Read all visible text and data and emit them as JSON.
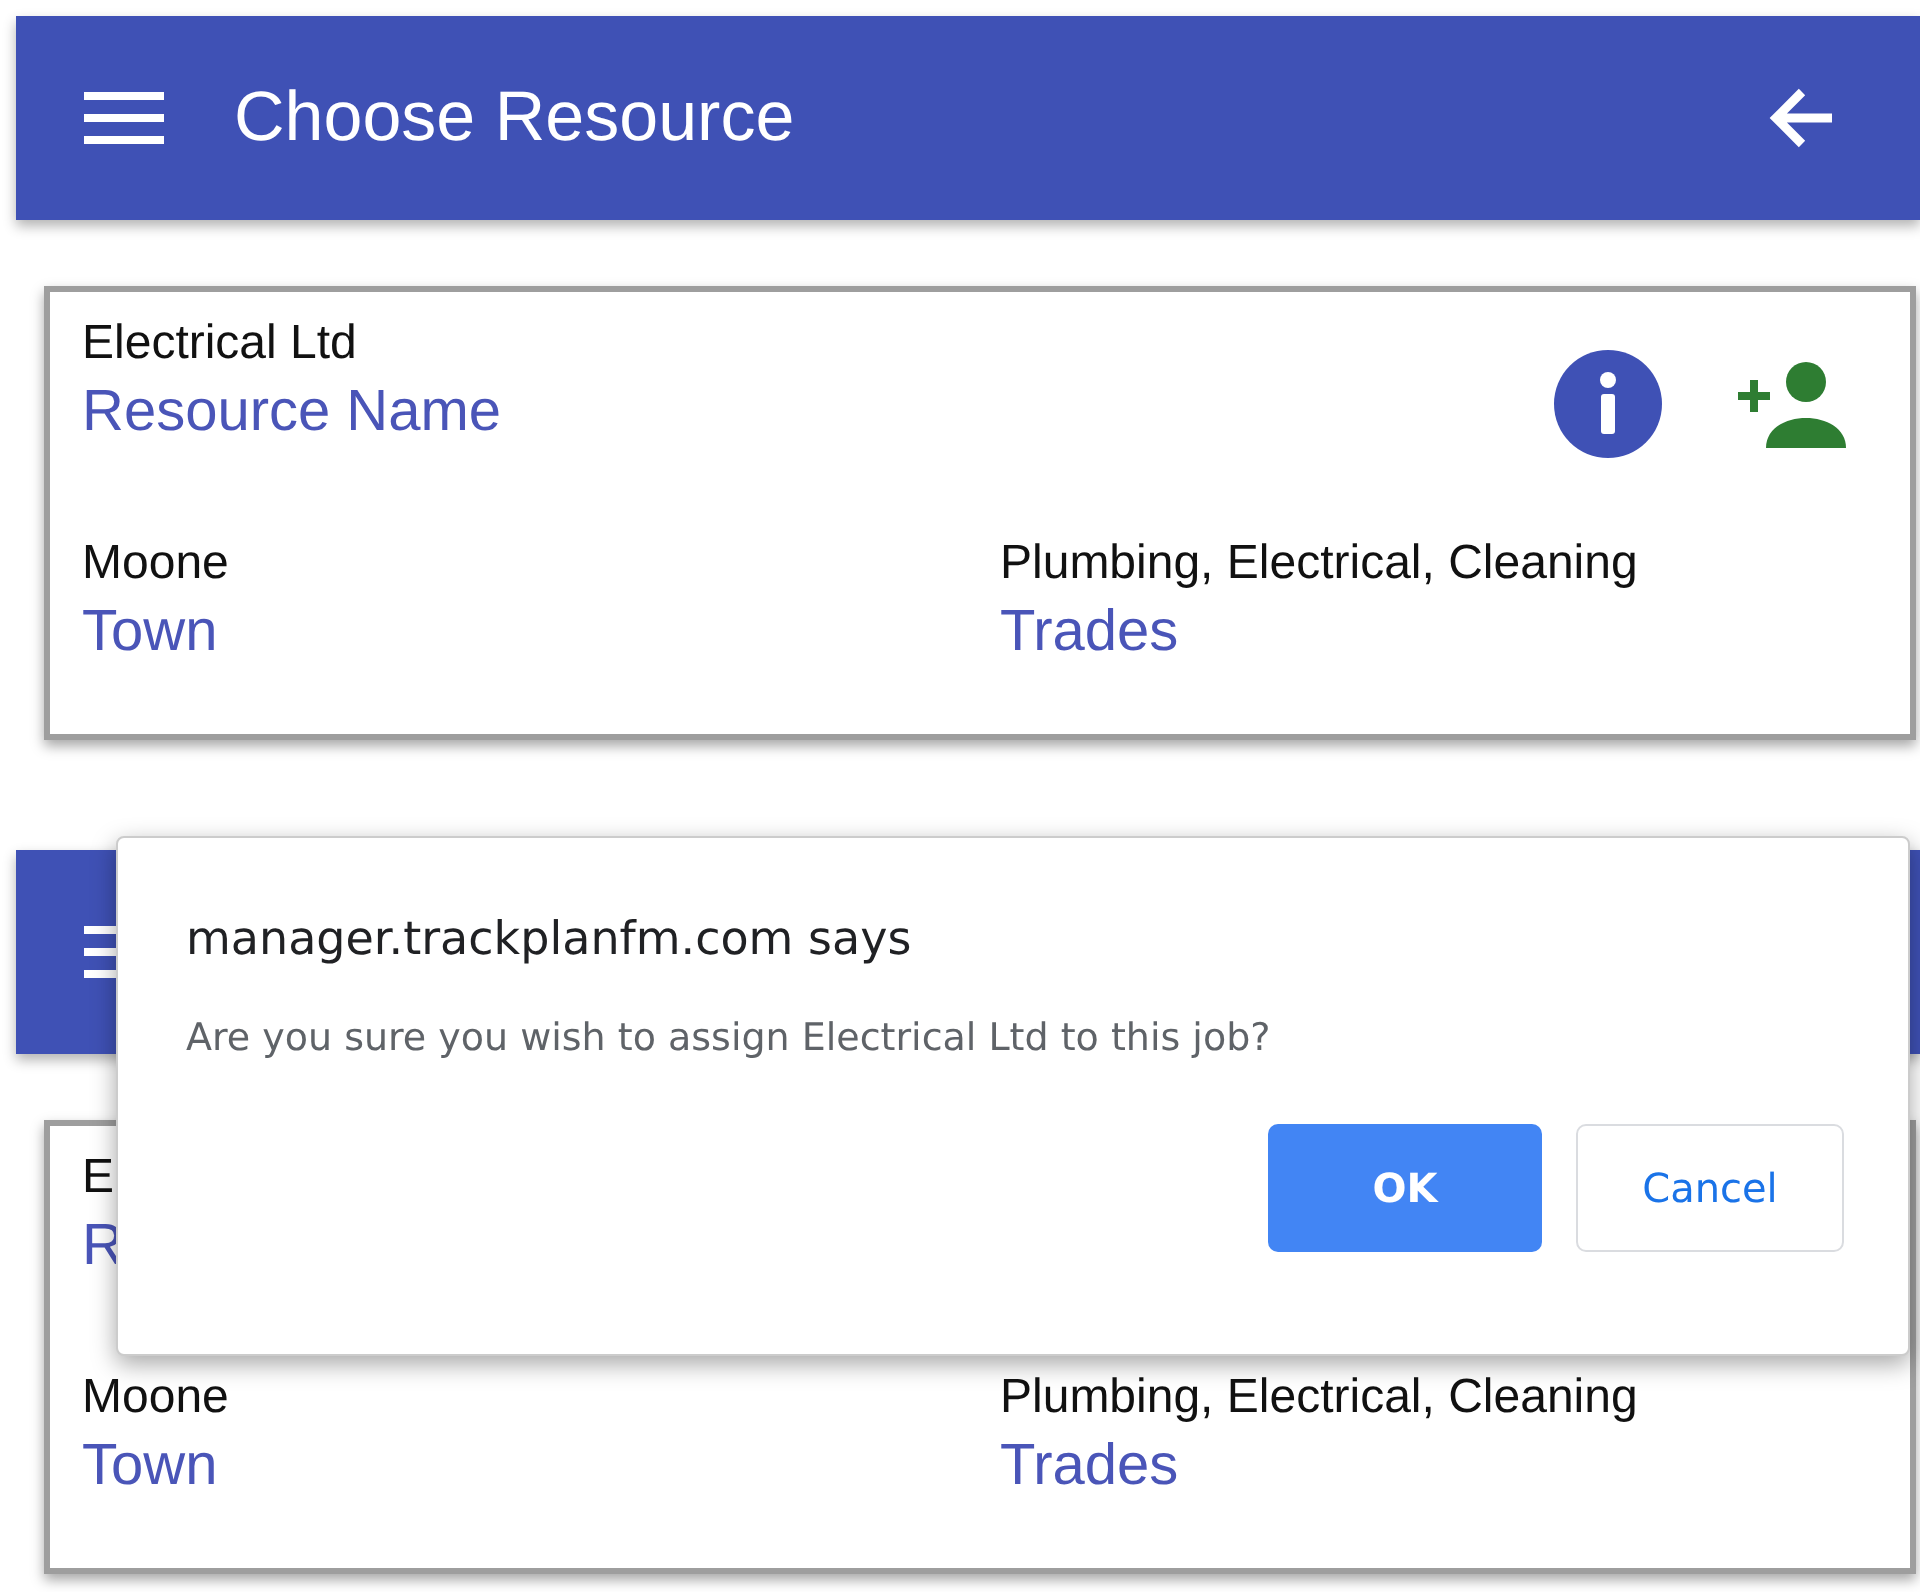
{
  "screens": [
    {
      "header": {
        "title": "Choose Resource",
        "back_button": true
      },
      "card": {
        "company": "Electrical Ltd",
        "company_label": "Resource Name",
        "town": "Moone",
        "town_label": "Town",
        "trades": "Plumbing, Electrical, Cleaning",
        "trades_label": "Trades",
        "actions": [
          {
            "kind": "info"
          },
          {
            "kind": "add_person"
          }
        ]
      }
    },
    {
      "card": {
        "company": "E",
        "company_label": "R",
        "town": "Moone",
        "town_label": "Town",
        "trades": "Plumbing, Electrical, Cleaning",
        "trades_label": "Trades"
      }
    }
  ],
  "dialog": {
    "origin": "manager.trackplanfm.com says",
    "message": "Are you sure you wish to assign Electrical Ltd to this job?",
    "buttons": [
      {
        "label": "OK",
        "kind": "primary"
      },
      {
        "label": "Cancel",
        "kind": "secondary"
      }
    ]
  }
}
